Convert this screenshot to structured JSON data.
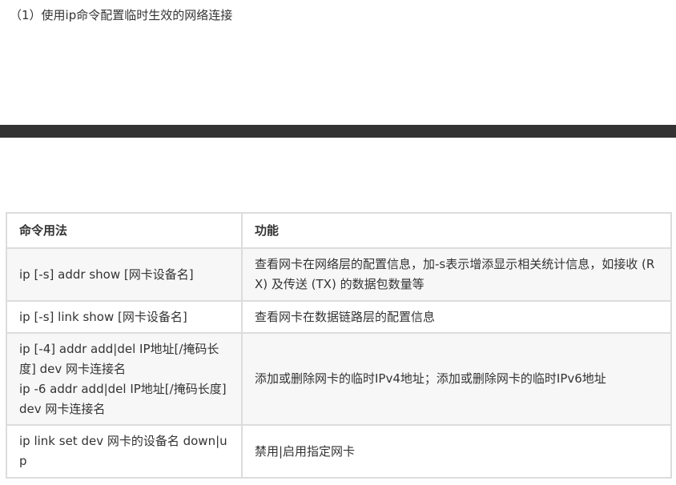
{
  "heading": "（1）使用ip命令配置临时生效的网络连接",
  "table": {
    "headers": [
      "命令用法",
      "功能"
    ],
    "rows": [
      {
        "usage": [
          "ip [-s] addr show [网卡设备名]"
        ],
        "function": "查看网卡在网络层的配置信息，加-s表示增添显示相关统计信息，如接收 (RX) 及传送 (TX) 的数据包数量等"
      },
      {
        "usage": [
          "ip [-s] link show [网卡设备名]"
        ],
        "function": "查看网卡在数据链路层的配置信息"
      },
      {
        "usage": [
          "ip [-4] addr add|del IP地址[/掩码长度] dev 网卡连接名",
          "ip -6 addr add|del IP地址[/掩码长度] dev 网卡连接名"
        ],
        "function": "添加或删除网卡的临时IPv4地址；添加或删除网卡的临时IPv6地址"
      },
      {
        "usage": [
          "ip link set dev 网卡的设备名 down|up"
        ],
        "function": "禁用|启用指定网卡"
      }
    ]
  },
  "colors": {
    "text": "#333333",
    "band": "#333333",
    "border": "#dcdcdc",
    "row_alt": "#f7f7f7"
  }
}
